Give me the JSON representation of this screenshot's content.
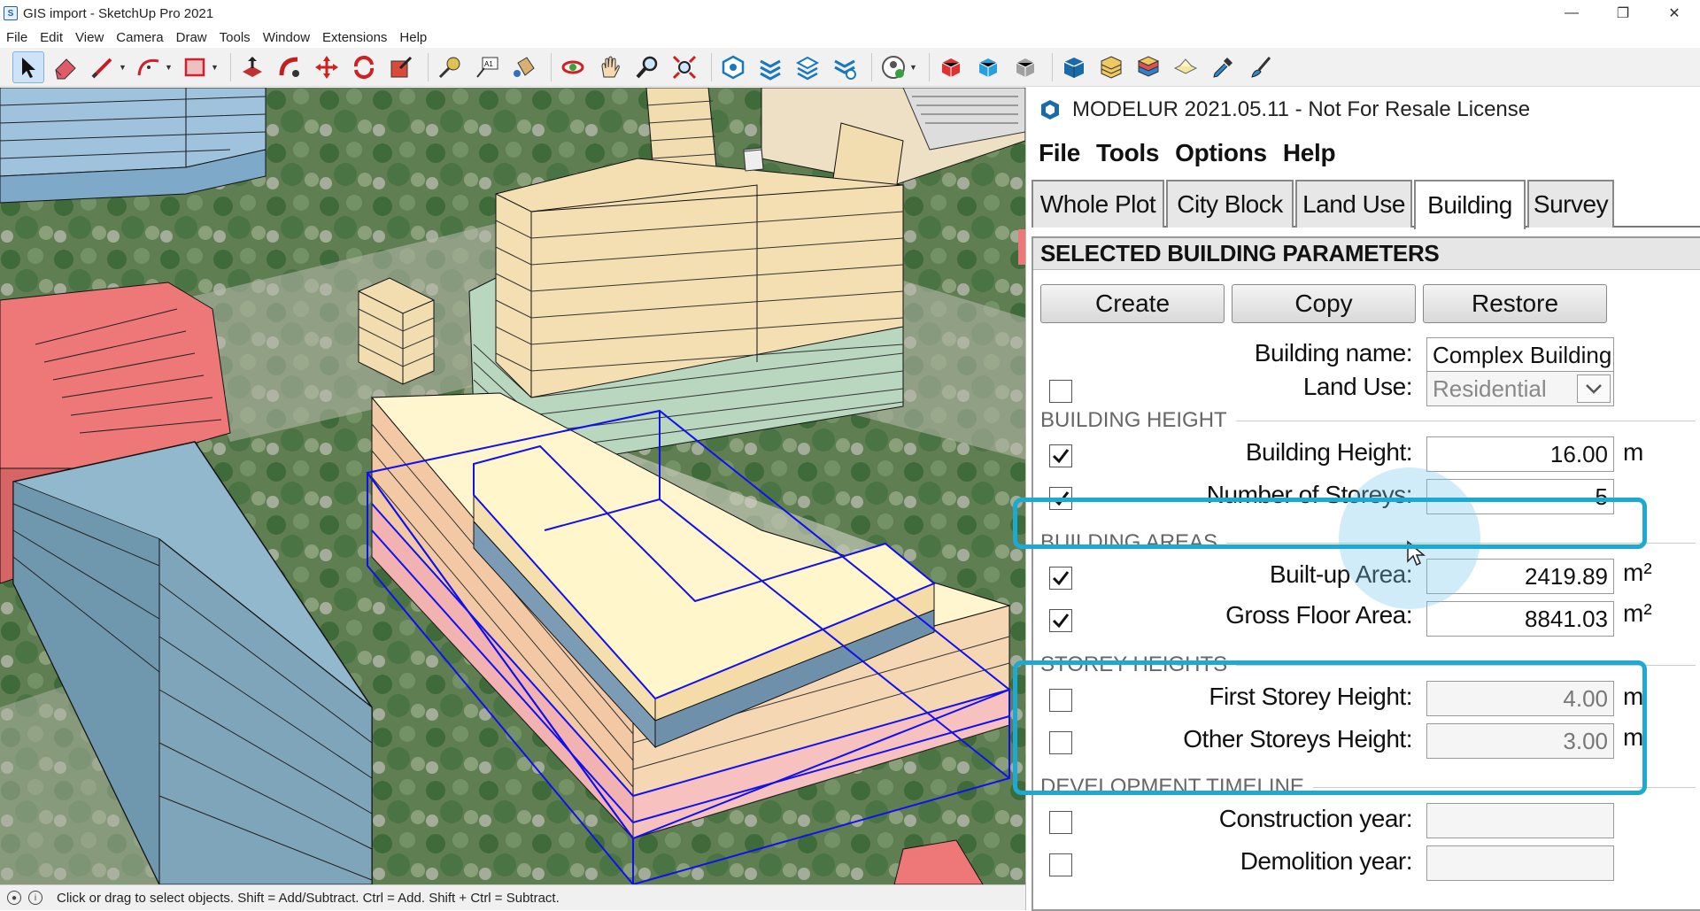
{
  "window": {
    "title": "GIS import - SketchUp Pro 2021"
  },
  "menu": [
    "File",
    "Edit",
    "View",
    "Camera",
    "Draw",
    "Tools",
    "Window",
    "Extensions",
    "Help"
  ],
  "statusbar": {
    "hint": "Click or drag to select objects. Shift = Add/Subtract. Ctrl = Add. Shift + Ctrl = Subtract."
  },
  "panel": {
    "title": "MODELUR 2021.05.11 - Not For Resale License",
    "menu": [
      "File",
      "Tools",
      "Options",
      "Help"
    ],
    "tabs": [
      "Whole Plot",
      "City Block",
      "Land Use",
      "Building",
      "Survey"
    ],
    "active_tab": "Building",
    "section_title": "SELECTED BUILDING PARAMETERS",
    "buttons": [
      "Create",
      "Copy",
      "Restore"
    ],
    "building_name_label": "Building name:",
    "building_name_value": "Complex Building",
    "land_use_label": "Land Use:",
    "land_use_value": "Residential",
    "groups": {
      "height": "BUILDING HEIGHT",
      "areas": "BUILDING AREAS",
      "storeys": "STOREY HEIGHTS",
      "timeline": "DEVELOPMENT TIMELINE"
    },
    "fields": {
      "building_height": {
        "label": "Building Height:",
        "value": "16.00",
        "unit": "m",
        "checked": true
      },
      "number_of_storeys": {
        "label": "Number of Storeys:",
        "value": "5",
        "checked": true
      },
      "built_up_area": {
        "label": "Built-up Area:",
        "value": "2419.89",
        "unit": "m²",
        "checked": true
      },
      "gross_floor_area": {
        "label": "Gross Floor Area:",
        "value": "8841.03",
        "unit": "m²",
        "checked": true
      },
      "first_storey_height": {
        "label": "First Storey Height:",
        "value": "4.00",
        "unit": "m",
        "checked": false
      },
      "other_storeys_height": {
        "label": "Other Storeys Height:",
        "value": "3.00",
        "unit": "m",
        "checked": false
      },
      "construction_year": {
        "label": "Construction year:",
        "value": "",
        "checked": false
      },
      "demolition_year": {
        "label": "Demolition year:",
        "value": "",
        "checked": false
      }
    }
  },
  "colors": {
    "highlight": "#1ea9d3",
    "selection": "#1010ee",
    "building_cream": "#f6e3b8",
    "building_red": "#ee7a7a",
    "building_blue": "#8fb7cf"
  }
}
